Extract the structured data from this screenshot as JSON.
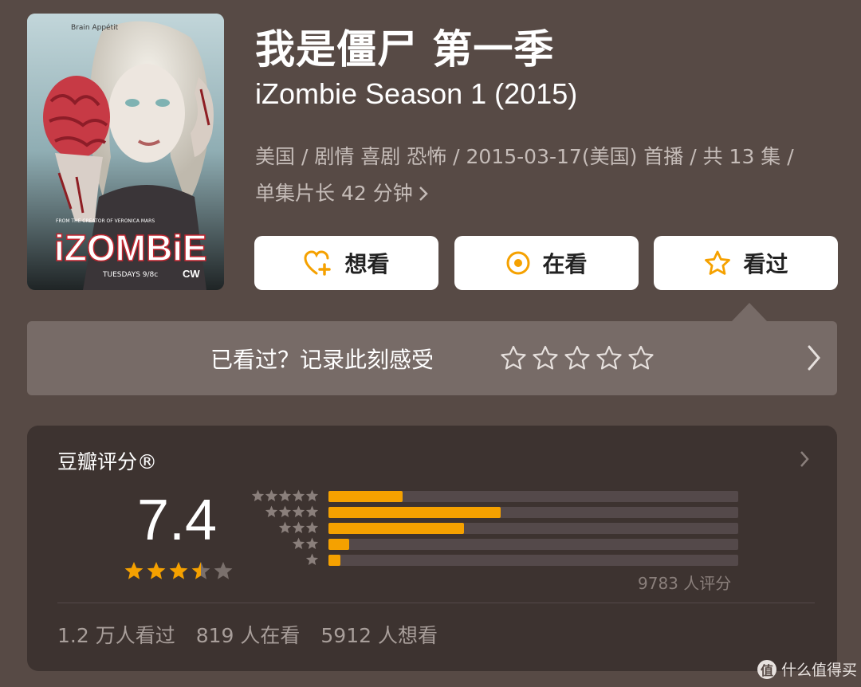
{
  "show": {
    "title_cn": "我是僵尸 第一季",
    "title_en": "iZombie Season 1 (2015)",
    "meta_line1": "美国 / 剧情 喜剧 恐怖 / 2015-03-17(美国) 首播 / 共 13 集 /",
    "meta_line2": "单集片长 42 分钟",
    "meta_more_icon": "chevron-right-icon"
  },
  "poster": {
    "tagline": "Brain Appétit",
    "logo": "iZOMBiE",
    "credit": "FROM THE CREATOR OF VERONICA MARS",
    "schedule": "TUESDAYS 9/8c",
    "network": "CW"
  },
  "actions": {
    "want": {
      "label": "想看",
      "icon": "heart-plus-icon"
    },
    "doing": {
      "label": "在看",
      "icon": "target-icon"
    },
    "done": {
      "label": "看过",
      "icon": "star-outline-icon"
    }
  },
  "rate_prompt": {
    "text": "已看过？记录此刻感受",
    "star_count": 5
  },
  "rating": {
    "label": "豆瓣评分®",
    "score": "7.4",
    "stars_value": 3.5,
    "stars_max": 5,
    "distribution": [
      {
        "stars": 5,
        "fraction": 0.18
      },
      {
        "stars": 4,
        "fraction": 0.42
      },
      {
        "stars": 3,
        "fraction": 0.33
      },
      {
        "stars": 2,
        "fraction": 0.05
      },
      {
        "stars": 1,
        "fraction": 0.03
      }
    ],
    "count_text": "9783 人评分"
  },
  "stats": {
    "watched": "1.2 万人看过",
    "watching": "819 人在看",
    "want": "5912 人想看"
  },
  "watermark": {
    "badge": "值",
    "text": "什么值得买"
  },
  "colors": {
    "background": "#574a45",
    "panel": "#3d3330",
    "strip": "#776b67",
    "accent": "#f5a100"
  }
}
